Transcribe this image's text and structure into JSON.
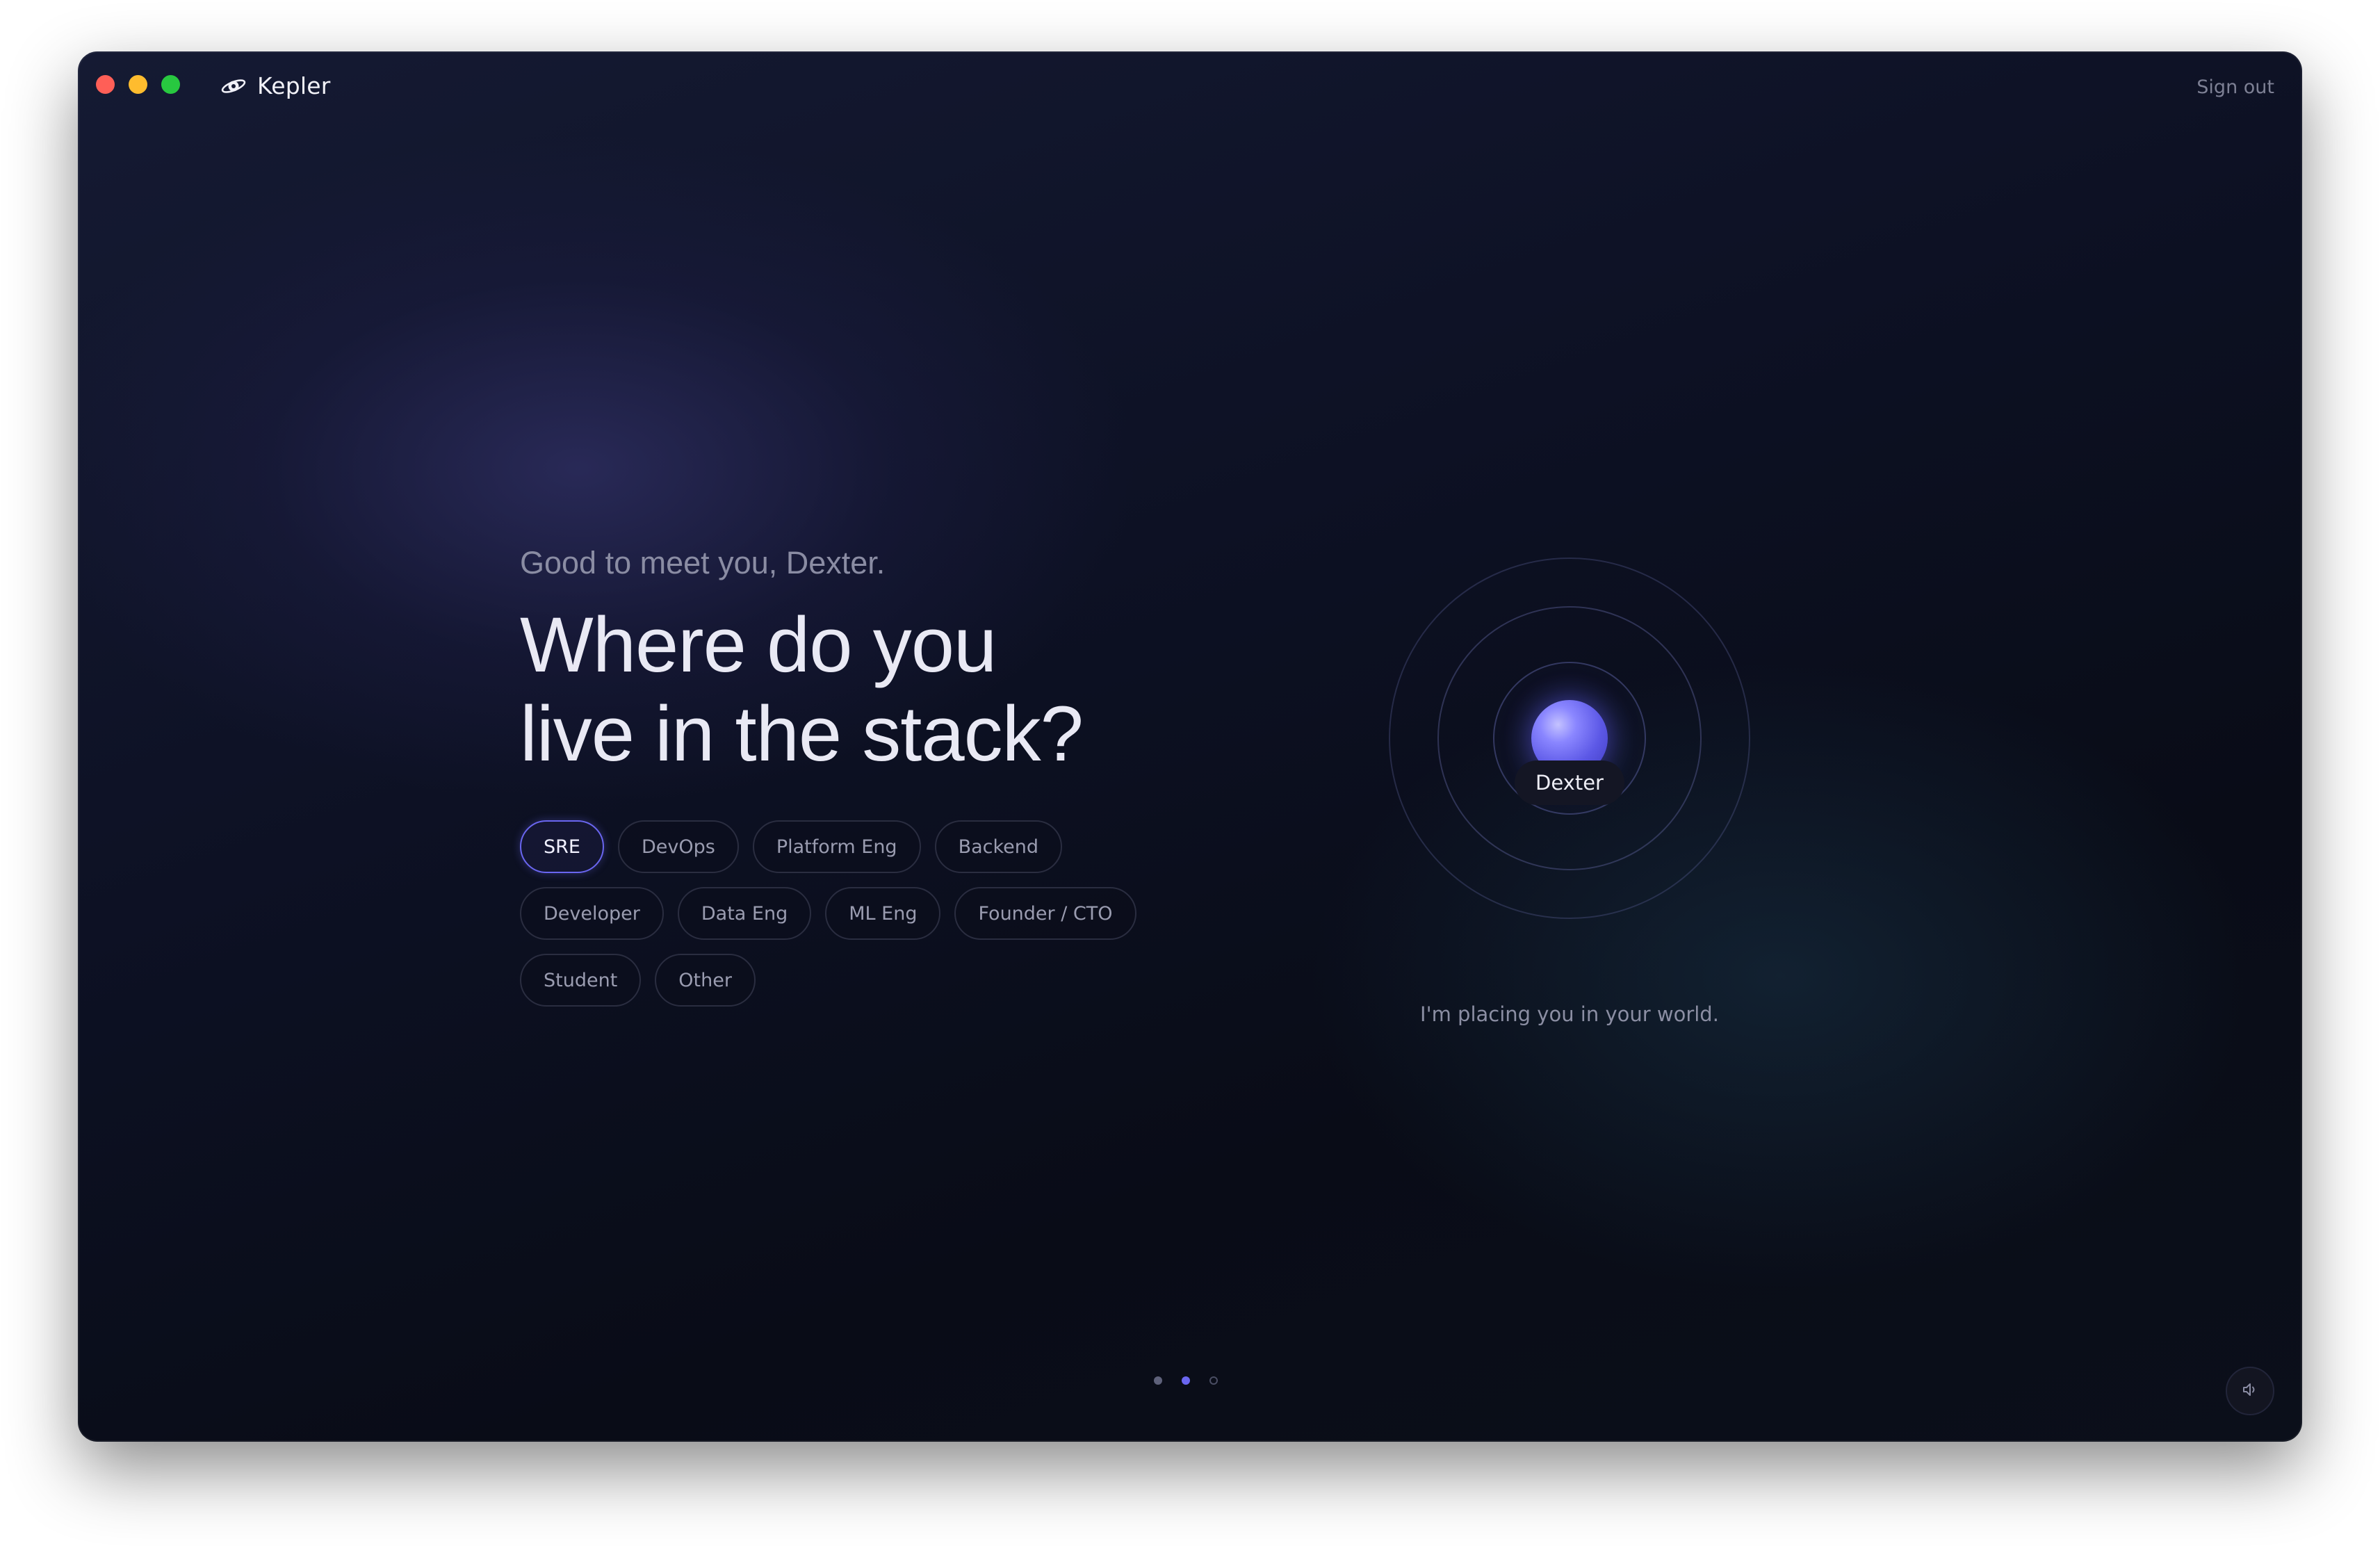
{
  "window": {
    "controls": [
      "close",
      "minimize",
      "maximize"
    ]
  },
  "header": {
    "app_name": "Kepler",
    "logo_icon": "planet-icon",
    "sign_out_label": "Sign out"
  },
  "onboarding": {
    "greeting": "Good to meet you, Dexter.",
    "headline_line1": "Where do you",
    "headline_line2": "live in the stack?",
    "selected_role": "SRE",
    "roles": [
      [
        "SRE",
        "DevOps",
        "Platform Eng",
        "Backend"
      ],
      [
        "Developer",
        "Data Eng",
        "ML Eng",
        "Founder / CTO"
      ],
      [
        "Student",
        "Other"
      ]
    ]
  },
  "orbit": {
    "user_label": "Dexter",
    "caption": "I'm placing you in your world."
  },
  "pagination": {
    "total_steps": 3,
    "current_step": 2
  },
  "controls": {
    "sound_icon": "speaker-icon"
  },
  "colors": {
    "accent": "#6a66f0",
    "background": "#0d1124",
    "text_primary": "#e9e9f4",
    "text_muted": "#8a8ca3"
  }
}
